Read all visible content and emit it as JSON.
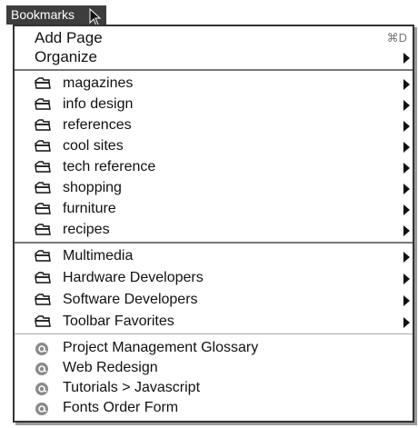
{
  "menubar": {
    "title": "Bookmarks"
  },
  "menu": {
    "add_page": {
      "label": "Add Page",
      "shortcut": "⌘D"
    },
    "organize": {
      "label": "Organize"
    },
    "folders_group1": [
      {
        "label": "magazines",
        "icon": "folder-icon"
      },
      {
        "label": "info design",
        "icon": "folder-icon"
      },
      {
        "label": "references",
        "icon": "folder-icon"
      },
      {
        "label": "cool sites",
        "icon": "folder-icon"
      },
      {
        "label": "tech reference",
        "icon": "folder-icon"
      },
      {
        "label": "shopping",
        "icon": "folder-icon"
      },
      {
        "label": "furniture",
        "icon": "folder-icon"
      },
      {
        "label": "recipes",
        "icon": "folder-icon"
      }
    ],
    "folders_group2": [
      {
        "label": "Multimedia",
        "icon": "folder-icon"
      },
      {
        "label": "Hardware Developers",
        "icon": "folder-icon"
      },
      {
        "label": "Software Developers",
        "icon": "folder-icon"
      },
      {
        "label": "Toolbar Favorites",
        "icon": "folder-icon"
      }
    ],
    "links": [
      {
        "label": "Project Management Glossary",
        "icon": "at-sign-icon"
      },
      {
        "label": "Web Redesign",
        "icon": "at-sign-icon"
      },
      {
        "label": "Tutorials > Javascript",
        "icon": "at-sign-icon"
      },
      {
        "label": "Fonts Order Form",
        "icon": "at-sign-icon"
      }
    ]
  },
  "colors": {
    "menubar_bg": "#3d3d3d",
    "menu_border": "#333333",
    "icon_gray": "#8a8a8a"
  }
}
